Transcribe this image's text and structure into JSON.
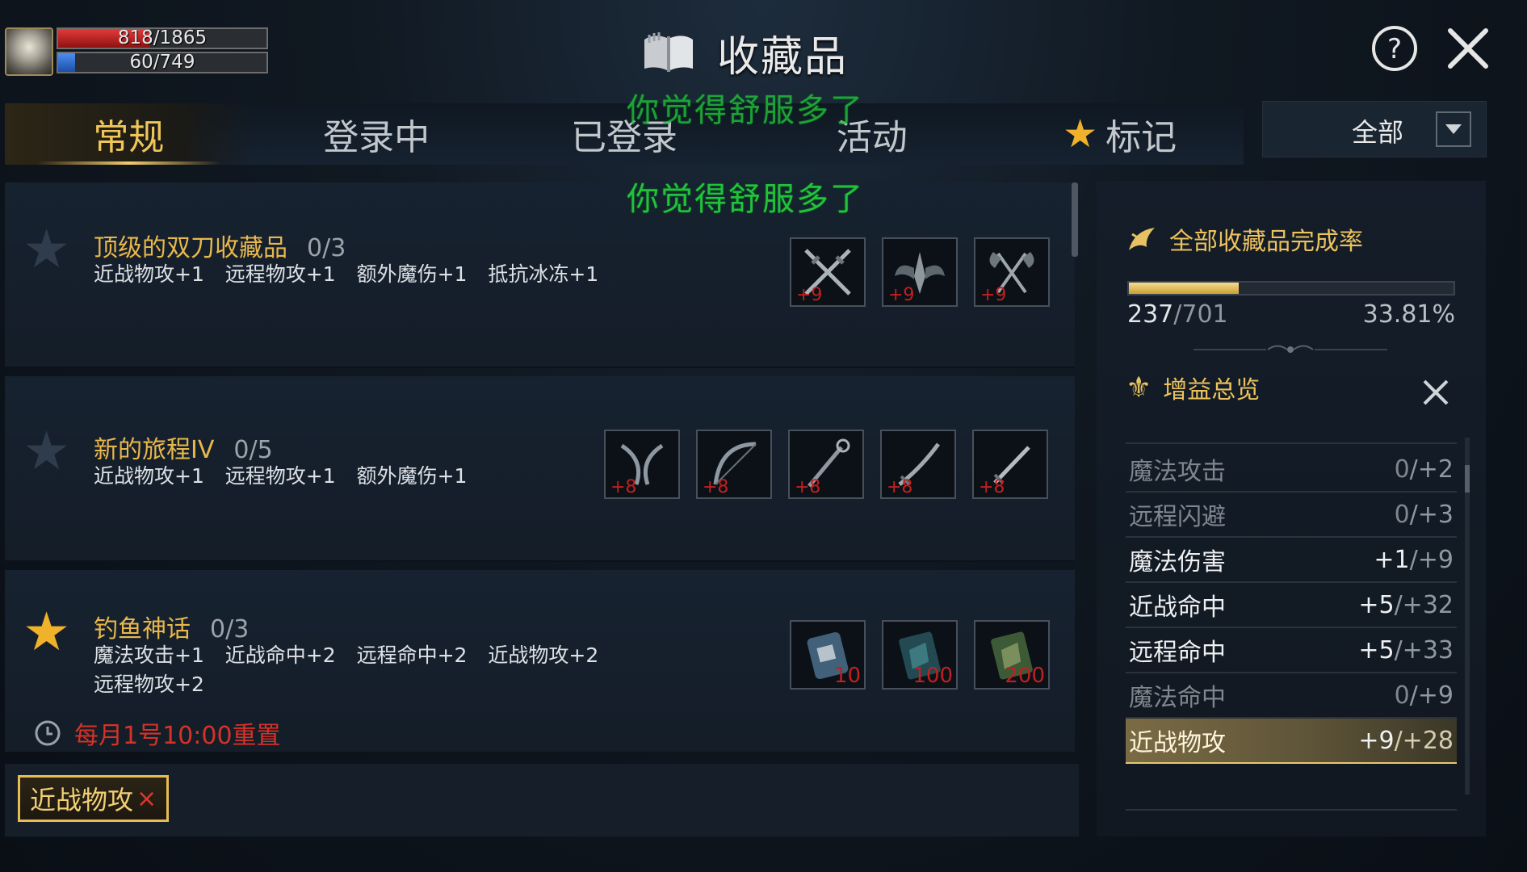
{
  "player": {
    "hp_text": "818/1865",
    "hp_fraction": 0.44,
    "mp_text": "60/749",
    "mp_fraction": 0.08
  },
  "header": {
    "title": "收藏品",
    "book_icon": "book-icon",
    "help_icon": "help-icon",
    "close_icon": "close-icon"
  },
  "overlay": {
    "line1": "你觉得舒服多了",
    "line2": "你觉得舒服多了",
    "color": "#22c23a"
  },
  "tabs": [
    {
      "label": "常规",
      "active": true
    },
    {
      "label": "登录中"
    },
    {
      "label": "已登录"
    },
    {
      "label": "活动"
    },
    {
      "label": "标记",
      "icon": "star-icon"
    }
  ],
  "filter": {
    "selected": "全部"
  },
  "collections": [
    {
      "title": "顶级的双刀收藏品",
      "progress": "0/3",
      "effects": "近战物攻+1   远程物攻+1   额外魔伤+1   抵抗冰冻+1",
      "starred": false,
      "items": [
        {
          "level": "+9",
          "icon": "crossed-swords-icon"
        },
        {
          "level": "+9",
          "icon": "winged-blade-icon"
        },
        {
          "level": "+9",
          "icon": "dual-axe-icon"
        }
      ]
    },
    {
      "title": "新的旅程IV",
      "progress": "0/5",
      "effects": "近战物攻+1   远程物攻+1   额外魔伤+1",
      "starred": false,
      "items": [
        {
          "level": "+8",
          "icon": "dual-blade-icon"
        },
        {
          "level": "+8",
          "icon": "bow-icon"
        },
        {
          "level": "+8",
          "icon": "staff-icon"
        },
        {
          "level": "+8",
          "icon": "sword-icon"
        },
        {
          "level": "+8",
          "icon": "dagger-icon"
        }
      ]
    },
    {
      "title": "钓鱼神话",
      "progress": "0/3",
      "effects": "魔法攻击+1   近战命中+2   远程命中+2   近战物攻+2   远程物攻+2",
      "starred": true,
      "reset": "每月1号10:00重置",
      "items": [
        {
          "count": "10",
          "icon": "scroll-icon"
        },
        {
          "count": "100",
          "icon": "map-scroll-icon"
        },
        {
          "count": "200",
          "icon": "green-scroll-icon"
        }
      ]
    }
  ],
  "tag_filter": {
    "label": "近战物攻",
    "remove": "×"
  },
  "panel": {
    "completion_title": "全部收藏品完成率",
    "completion_count": "237",
    "completion_total": "/701",
    "completion_percent": "33.81%",
    "completion_fraction": 0.338,
    "buff_title": "增益总览",
    "buffs": [
      {
        "name": "魔法攻击",
        "current": "0",
        "max": "/+2",
        "style": "dim"
      },
      {
        "name": "远程闪避",
        "current": "0",
        "max": "/+3",
        "style": "dim"
      },
      {
        "name": "魔法伤害",
        "current": "+1",
        "max": "/+9",
        "style": "bright"
      },
      {
        "name": "近战命中",
        "current": "+5",
        "max": "/+32",
        "style": "bright"
      },
      {
        "name": "远程命中",
        "current": "+5",
        "max": "/+33",
        "style": "bright"
      },
      {
        "name": "魔法命中",
        "current": "0",
        "max": "/+9",
        "style": "dim"
      },
      {
        "name": "近战物攻",
        "current": "+9",
        "max": "/+28",
        "style": "hl"
      }
    ]
  },
  "colors": {
    "gold": "#e8b84a",
    "red": "#d63227",
    "bg": "#101821"
  }
}
